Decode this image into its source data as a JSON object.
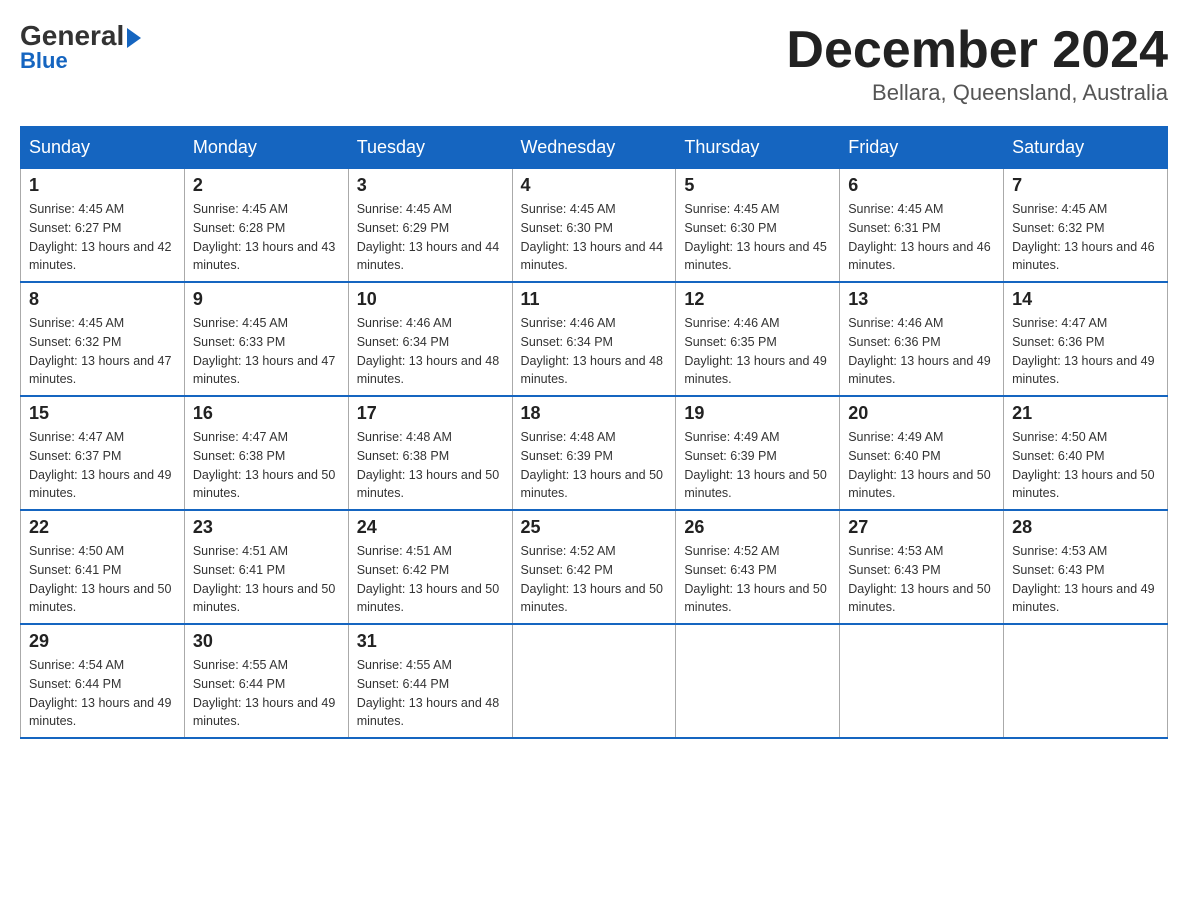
{
  "header": {
    "logo_text_general": "General",
    "logo_text_blue": "Blue",
    "month_title": "December 2024",
    "location": "Bellara, Queensland, Australia"
  },
  "days_of_week": [
    "Sunday",
    "Monday",
    "Tuesday",
    "Wednesday",
    "Thursday",
    "Friday",
    "Saturday"
  ],
  "weeks": [
    [
      {
        "day": "1",
        "sunrise": "4:45 AM",
        "sunset": "6:27 PM",
        "daylight": "13 hours and 42 minutes."
      },
      {
        "day": "2",
        "sunrise": "4:45 AM",
        "sunset": "6:28 PM",
        "daylight": "13 hours and 43 minutes."
      },
      {
        "day": "3",
        "sunrise": "4:45 AM",
        "sunset": "6:29 PM",
        "daylight": "13 hours and 44 minutes."
      },
      {
        "day": "4",
        "sunrise": "4:45 AM",
        "sunset": "6:30 PM",
        "daylight": "13 hours and 44 minutes."
      },
      {
        "day": "5",
        "sunrise": "4:45 AM",
        "sunset": "6:30 PM",
        "daylight": "13 hours and 45 minutes."
      },
      {
        "day": "6",
        "sunrise": "4:45 AM",
        "sunset": "6:31 PM",
        "daylight": "13 hours and 46 minutes."
      },
      {
        "day": "7",
        "sunrise": "4:45 AM",
        "sunset": "6:32 PM",
        "daylight": "13 hours and 46 minutes."
      }
    ],
    [
      {
        "day": "8",
        "sunrise": "4:45 AM",
        "sunset": "6:32 PM",
        "daylight": "13 hours and 47 minutes."
      },
      {
        "day": "9",
        "sunrise": "4:45 AM",
        "sunset": "6:33 PM",
        "daylight": "13 hours and 47 minutes."
      },
      {
        "day": "10",
        "sunrise": "4:46 AM",
        "sunset": "6:34 PM",
        "daylight": "13 hours and 48 minutes."
      },
      {
        "day": "11",
        "sunrise": "4:46 AM",
        "sunset": "6:34 PM",
        "daylight": "13 hours and 48 minutes."
      },
      {
        "day": "12",
        "sunrise": "4:46 AM",
        "sunset": "6:35 PM",
        "daylight": "13 hours and 49 minutes."
      },
      {
        "day": "13",
        "sunrise": "4:46 AM",
        "sunset": "6:36 PM",
        "daylight": "13 hours and 49 minutes."
      },
      {
        "day": "14",
        "sunrise": "4:47 AM",
        "sunset": "6:36 PM",
        "daylight": "13 hours and 49 minutes."
      }
    ],
    [
      {
        "day": "15",
        "sunrise": "4:47 AM",
        "sunset": "6:37 PM",
        "daylight": "13 hours and 49 minutes."
      },
      {
        "day": "16",
        "sunrise": "4:47 AM",
        "sunset": "6:38 PM",
        "daylight": "13 hours and 50 minutes."
      },
      {
        "day": "17",
        "sunrise": "4:48 AM",
        "sunset": "6:38 PM",
        "daylight": "13 hours and 50 minutes."
      },
      {
        "day": "18",
        "sunrise": "4:48 AM",
        "sunset": "6:39 PM",
        "daylight": "13 hours and 50 minutes."
      },
      {
        "day": "19",
        "sunrise": "4:49 AM",
        "sunset": "6:39 PM",
        "daylight": "13 hours and 50 minutes."
      },
      {
        "day": "20",
        "sunrise": "4:49 AM",
        "sunset": "6:40 PM",
        "daylight": "13 hours and 50 minutes."
      },
      {
        "day": "21",
        "sunrise": "4:50 AM",
        "sunset": "6:40 PM",
        "daylight": "13 hours and 50 minutes."
      }
    ],
    [
      {
        "day": "22",
        "sunrise": "4:50 AM",
        "sunset": "6:41 PM",
        "daylight": "13 hours and 50 minutes."
      },
      {
        "day": "23",
        "sunrise": "4:51 AM",
        "sunset": "6:41 PM",
        "daylight": "13 hours and 50 minutes."
      },
      {
        "day": "24",
        "sunrise": "4:51 AM",
        "sunset": "6:42 PM",
        "daylight": "13 hours and 50 minutes."
      },
      {
        "day": "25",
        "sunrise": "4:52 AM",
        "sunset": "6:42 PM",
        "daylight": "13 hours and 50 minutes."
      },
      {
        "day": "26",
        "sunrise": "4:52 AM",
        "sunset": "6:43 PM",
        "daylight": "13 hours and 50 minutes."
      },
      {
        "day": "27",
        "sunrise": "4:53 AM",
        "sunset": "6:43 PM",
        "daylight": "13 hours and 50 minutes."
      },
      {
        "day": "28",
        "sunrise": "4:53 AM",
        "sunset": "6:43 PM",
        "daylight": "13 hours and 49 minutes."
      }
    ],
    [
      {
        "day": "29",
        "sunrise": "4:54 AM",
        "sunset": "6:44 PM",
        "daylight": "13 hours and 49 minutes."
      },
      {
        "day": "30",
        "sunrise": "4:55 AM",
        "sunset": "6:44 PM",
        "daylight": "13 hours and 49 minutes."
      },
      {
        "day": "31",
        "sunrise": "4:55 AM",
        "sunset": "6:44 PM",
        "daylight": "13 hours and 48 minutes."
      },
      null,
      null,
      null,
      null
    ]
  ]
}
